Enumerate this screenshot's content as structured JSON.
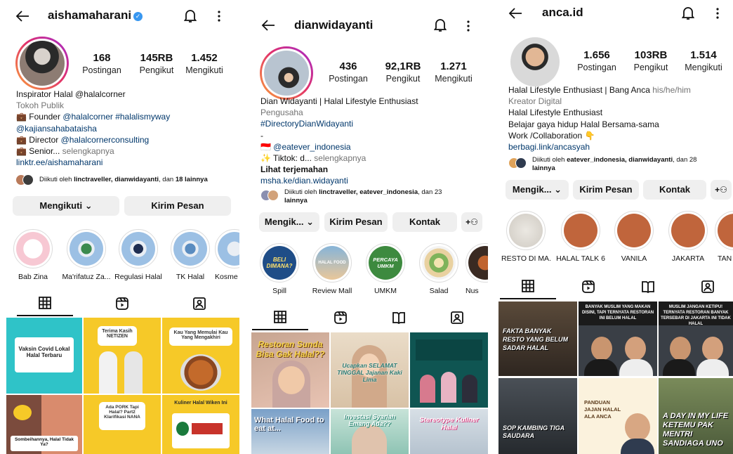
{
  "panels": [
    {
      "username": "aishamaharani",
      "verified": true,
      "stats": [
        {
          "num": "168",
          "label": "Postingan"
        },
        {
          "num": "145RB",
          "label": "Pengikut"
        },
        {
          "num": "1.452",
          "label": "Mengikuti"
        }
      ],
      "bio": {
        "name": "Inspirator Halal @halalcorner",
        "category": "Tokoh Publik",
        "line1_prefix": "💼 Founder ",
        "line1_tags": "@halalcorner #halalismyway",
        "line2": "@kajiansahabataisha",
        "line3_prefix": "💼 Director ",
        "line3_tag": "@halalcornerconsulting",
        "line4_prefix": "💼 Senior... ",
        "line4_more": "selengkapnya",
        "link": "linktr.ee/aishamaharani"
      },
      "followed_by": {
        "prefix": "Diikuti oleh ",
        "names": "linctraveller, dianwidayanti",
        "mid": ", dan ",
        "count": "18 lainnya"
      },
      "buttons": {
        "follow": "Mengikuti",
        "message": "Kirim Pesan"
      },
      "highlights": [
        "Bab Zina",
        "Ma'rifatuz Za...",
        "Regulasi Halal",
        "TK Halal",
        "Kosme"
      ],
      "posts": [
        {
          "text": "Vaksin Covid Lokal Halal Terbaru"
        },
        {
          "text": "Terima Kasih NETIZEN"
        },
        {
          "text": "Kau Yang Memulai Kau Yang Mengakhiri"
        },
        {
          "text": "Sombeihannya, Halal Tidak Ya?"
        },
        {
          "text": "Ada PORK Tapi Halal? Part2 Klarifikasi NANA"
        },
        {
          "text": "Kuliner Halal Wiken Ini"
        }
      ]
    },
    {
      "username": "dianwidayanti",
      "stats": [
        {
          "num": "436",
          "label": "Postingan"
        },
        {
          "num": "92,1RB",
          "label": "Pengikut"
        },
        {
          "num": "1.271",
          "label": "Mengikuti"
        }
      ],
      "bio": {
        "name": "Dian Widayanti | Halal Lifestyle Enthusiast",
        "category": "Pengusaha",
        "line1": "#DirectoryDianWidayanti",
        "line2": "-",
        "line3_prefix": "🇮🇩 ",
        "line3_tag": "@eatever_indonesia",
        "line4_prefix": "✨ Tiktok: d... ",
        "line4_more": "selengkapnya",
        "translate": "Lihat terjemahan",
        "link": "msha.ke/dian.widayanti"
      },
      "followed_by": {
        "prefix": "Diikuti oleh ",
        "names": "linctraveller, eatever_indonesia",
        "mid": ", dan 23",
        "count": "lainnya"
      },
      "buttons": {
        "follow": "Mengik...",
        "message": "Kirim Pesan",
        "contact": "Kontak"
      },
      "highlights": [
        "Spill",
        "Review Mall",
        "UMKM",
        "Salad",
        "Nus"
      ],
      "highlight_covers": [
        "BELI DIMANA?",
        "HALAL FOOD",
        "PERCAYA UMKM",
        "",
        ""
      ],
      "posts": [
        {
          "text": "Restoran Sunda Bisa Gak Halal??"
        },
        {
          "text": "Ucapkan SELAMAT TINGGAL Jajanan Kaki Lima"
        },
        {
          "text": ""
        },
        {
          "text": "What Halal Food to eat at..."
        },
        {
          "text": "Investasi Syariah Emang Ada??"
        },
        {
          "text": "Stereotype Kuliner Halal"
        }
      ]
    },
    {
      "username": "anca.id",
      "stats": [
        {
          "num": "1.656",
          "label": "Postingan"
        },
        {
          "num": "103RB",
          "label": "Pengikut"
        },
        {
          "num": "1.514",
          "label": "Mengikuti"
        }
      ],
      "bio": {
        "name": "Halal Lifestyle Enthusiast | Bang Anca",
        "pronoun": " his/he/him",
        "category": "Kreator Digital",
        "line1": "Halal Lifestyle Enthusiast",
        "line2": "Belajar gaya hidup Halal Bersama-sama",
        "line3": "Work /Collaboration 👇",
        "link": "berbagi.link/ancasyah"
      },
      "followed_by": {
        "prefix": "Diikuti oleh ",
        "names": "eatever_indonesia, dianwidayanti",
        "mid": ", dan 28",
        "count": "lainnya"
      },
      "buttons": {
        "follow": "Mengik...",
        "message": "Kirim Pesan",
        "contact": "Kontak"
      },
      "highlights": [
        "RESTO DI MA...",
        "HALAL TALK 6",
        "VANILA",
        "JAKARTA",
        "TAN"
      ],
      "posts": [
        {
          "text": "FAKTA BANYAK RESTO YANG BELUM SADAR HALAL"
        },
        {
          "text": "BANYAK MUSLIM YANG MAKAN DISINI, TAPI TERNYATA RESTORAN INI BELUM HALAL"
        },
        {
          "text": "MUSLIM JANGAN KETIPU! TERNYATA RESTORAN BANYAK TERSEBAR DI JAKARTA INI TIDAK HALAL"
        },
        {
          "text": "SOP KAMBING TIGA SAUDARA"
        },
        {
          "text": "PANDUAN JAJAN HALAL ALA ANCA"
        },
        {
          "text": "A DAY IN MY LIFE KETEMU PAK MENTRI SANDIAGA UNO"
        }
      ]
    }
  ],
  "colors": {
    "link": "#00376b",
    "verified": "#3897f0",
    "button_bg": "#efefef",
    "muted": "#737373"
  }
}
